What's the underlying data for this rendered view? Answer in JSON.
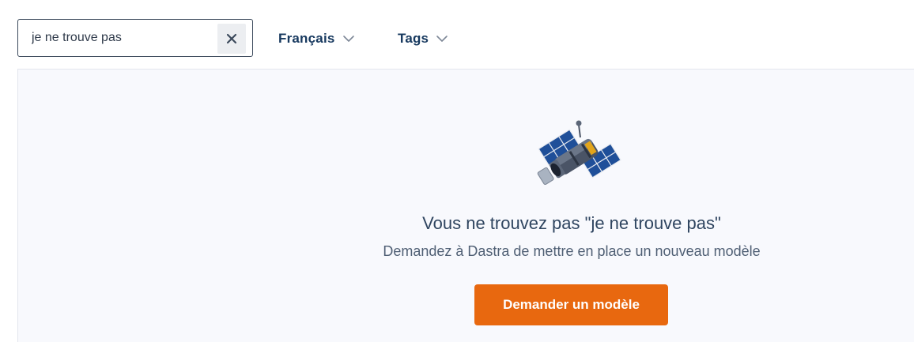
{
  "search": {
    "value": "je ne trouve pas",
    "clear_icon": "close-icon"
  },
  "filters": {
    "language": {
      "label": "Français",
      "icon": "chevron-down-icon"
    },
    "tags": {
      "label": "Tags",
      "icon": "chevron-down-icon"
    }
  },
  "empty_state": {
    "illustration": "satellite-icon",
    "title": "Vous ne trouvez pas \"je ne trouve pas\"",
    "subtitle": "Demandez à Dastra de mettre en place un nouveau modèle",
    "button_label": "Demander un modèle"
  },
  "colors": {
    "accent_button": "#e8680f",
    "dropdown_text": "#17395f",
    "title_text": "#2f4560",
    "panel_background": "#f8f9fd"
  }
}
